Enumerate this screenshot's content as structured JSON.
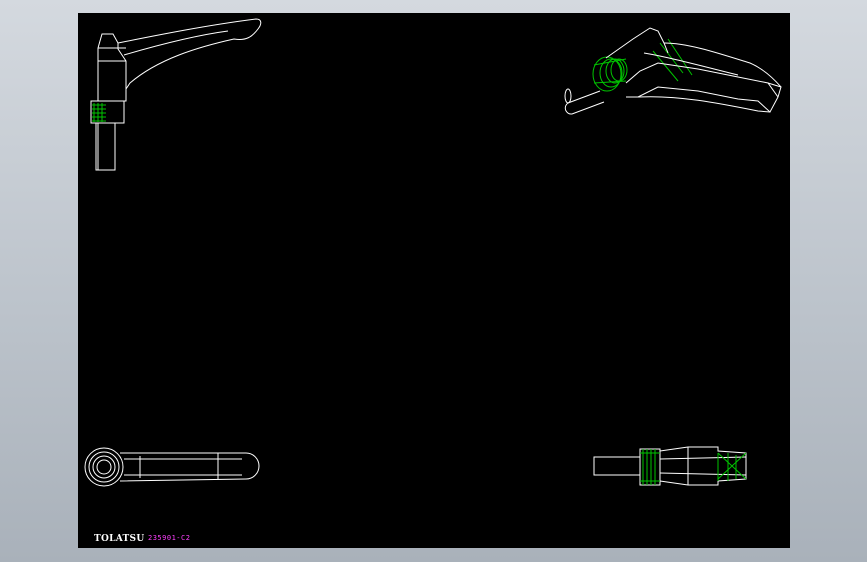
{
  "sheet": {
    "logo_text": "TOLATSU",
    "part_number": "235901-C2"
  },
  "colors": {
    "background_top": "#d4d9df",
    "background_bottom": "#a9b1ba",
    "sheet": "#000000",
    "line": "#ffffff",
    "thread": "#00c400",
    "part_number": "#ff40ff"
  },
  "views": [
    {
      "name": "side-view"
    },
    {
      "name": "isometric-view"
    },
    {
      "name": "top-view"
    },
    {
      "name": "end-view"
    }
  ]
}
